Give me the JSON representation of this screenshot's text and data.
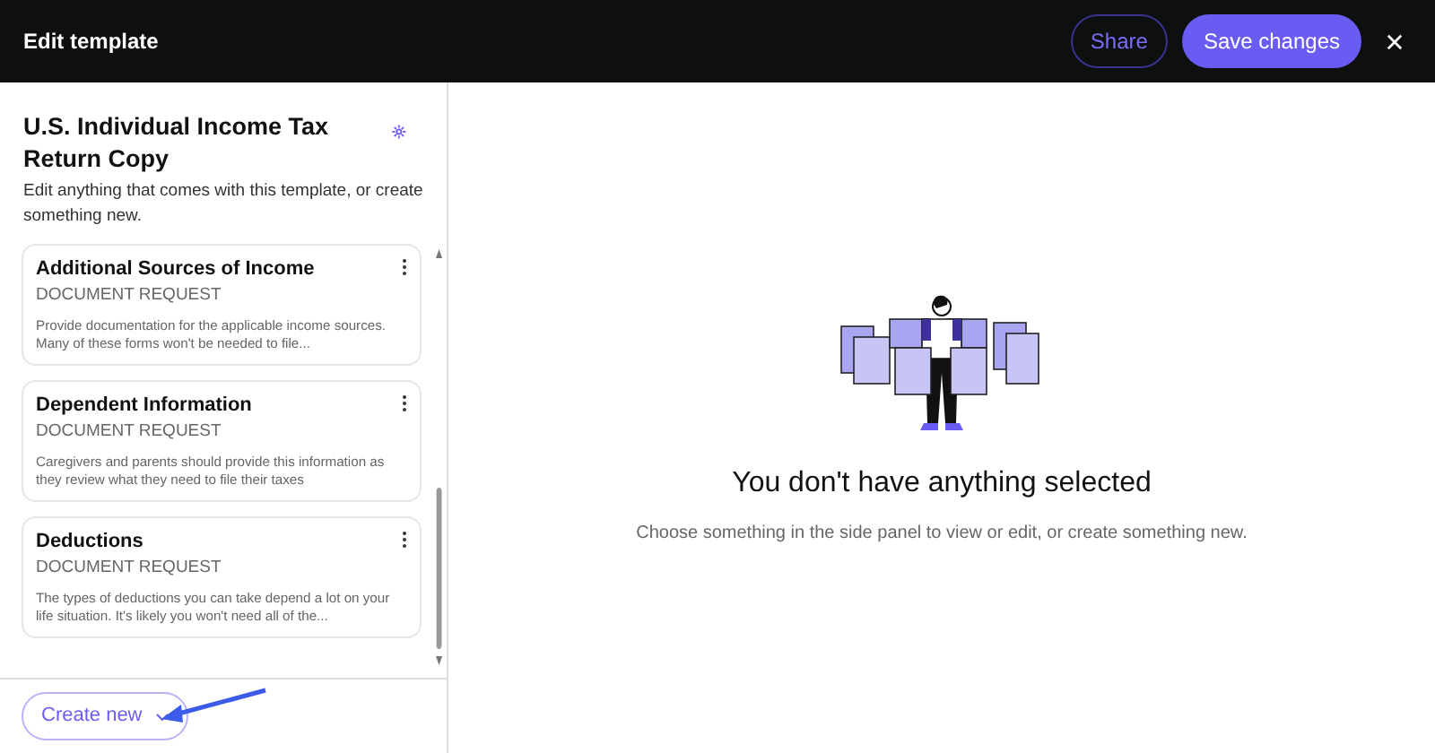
{
  "header": {
    "title": "Edit template",
    "buttons": [
      {
        "label": "Share",
        "kind": "outline"
      },
      {
        "label": "Save changes",
        "kind": "primary"
      }
    ]
  },
  "sidebar": {
    "title": "U.S. Individual Income Tax Return Copy",
    "subtitle": "Edit anything that comes with this template, or create something new.",
    "items": [
      {
        "title": "Additional Sources of Income",
        "type": "DOCUMENT REQUEST",
        "description": "Provide documentation for the applicable income sources. Many of these forms won't be needed to file..."
      },
      {
        "title": "Dependent Information",
        "type": "DOCUMENT REQUEST",
        "description": "Caregivers and parents should provide this information as they review what they need to file their taxes"
      },
      {
        "title": "Deductions",
        "type": "DOCUMENT REQUEST",
        "description": "The types of deductions you can take depend a lot on your life situation. It's likely you won't need all of the..."
      }
    ],
    "create_button": "Create new"
  },
  "empty_state": {
    "title": "You don't have anything selected",
    "message": "Choose something in the side panel to view or edit, or create something new."
  }
}
